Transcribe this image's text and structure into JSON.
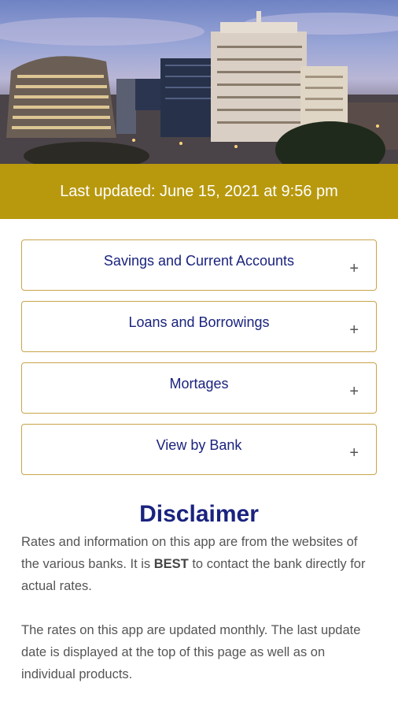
{
  "banner": {
    "text": "Last updated: June 15, 2021 at 9:56 pm"
  },
  "accordion": [
    {
      "label": "Savings and Current Accounts",
      "icon": "plus-icon",
      "symbol": "+"
    },
    {
      "label": "Loans and Borrowings",
      "icon": "plus-icon",
      "symbol": "+"
    },
    {
      "label": "Mortages",
      "icon": "plus-icon",
      "symbol": "+"
    },
    {
      "label": "View by Bank",
      "icon": "plus-icon",
      "symbol": "+"
    }
  ],
  "disclaimer": {
    "title": "Disclaimer",
    "p1_before": "Rates and information on this app are from the websites of the various banks. It is ",
    "p1_bold": "BEST",
    "p1_after": " to contact the bank directly for actual rates.",
    "p2": "The rates on this app are updated monthly. The last update date is displayed at the top of this page as well as on individual products."
  },
  "colors": {
    "gold": "#b8990e",
    "navy": "#1a237e",
    "border": "#c9a54a"
  }
}
